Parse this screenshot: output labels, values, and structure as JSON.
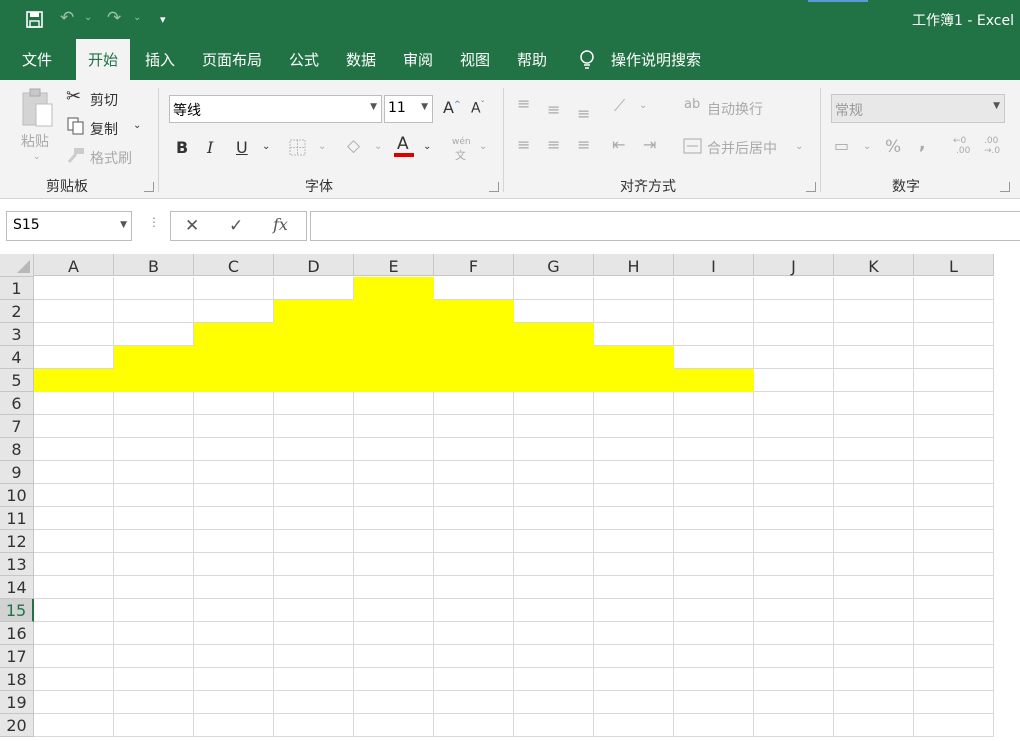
{
  "titlebar": {
    "title": "工作簿1  -  Excel",
    "save_icon": "save-icon",
    "undo_icon": "undo-icon",
    "redo_icon": "redo-icon",
    "customize_icon": "customize-qat-icon"
  },
  "tabs": [
    "文件",
    "开始",
    "插入",
    "页面布局",
    "公式",
    "数据",
    "审阅",
    "视图",
    "帮助"
  ],
  "active_tab": "开始",
  "tell_me": "操作说明搜索",
  "ribbon": {
    "clipboard": {
      "paste": "粘贴",
      "cut": "剪切",
      "copy": "复制",
      "format_painter": "格式刷",
      "label": "剪贴板"
    },
    "font": {
      "name": "等线",
      "size": "11",
      "label": "字体",
      "bold": "B",
      "italic": "I",
      "underline": "U",
      "font_color": "A",
      "phonetic_top": "wén",
      "phonetic_bottom": "文"
    },
    "alignment": {
      "wrap": "自动换行",
      "merge": "合并后居中",
      "label": "对齐方式"
    },
    "number": {
      "format": "常规",
      "percent": "%",
      "comma": ",",
      "label": "数字",
      "inc_decimal_top": "←0",
      "inc_decimal_bottom": ".00",
      "dec_decimal_top": ".00",
      "dec_decimal_bottom": "→.0"
    }
  },
  "formula_bar": {
    "name_box": "S15",
    "cancel": "✕",
    "enter": "✓",
    "fx": "fx",
    "value": ""
  },
  "sheet": {
    "columns": [
      "A",
      "B",
      "C",
      "D",
      "E",
      "F",
      "G",
      "H",
      "I",
      "J",
      "K",
      "L"
    ],
    "rows": [
      "1",
      "2",
      "3",
      "4",
      "5",
      "6",
      "7",
      "8",
      "9",
      "10",
      "11",
      "12",
      "13",
      "14",
      "15",
      "16",
      "17",
      "18",
      "19",
      "20"
    ],
    "selected_row": "15",
    "highlight_color": "#ffff00",
    "yellow_cells": {
      "1": [
        "E"
      ],
      "2": [
        "D",
        "E",
        "F"
      ],
      "3": [
        "C",
        "D",
        "E",
        "F",
        "G"
      ],
      "4": [
        "B",
        "C",
        "D",
        "E",
        "F",
        "G",
        "H"
      ],
      "5": [
        "A",
        "B",
        "C",
        "D",
        "E",
        "F",
        "G",
        "H",
        "I"
      ]
    }
  },
  "colors": {
    "brand": "#217346",
    "highlight": "#ffff00",
    "font_color_bar": "#e00000"
  }
}
